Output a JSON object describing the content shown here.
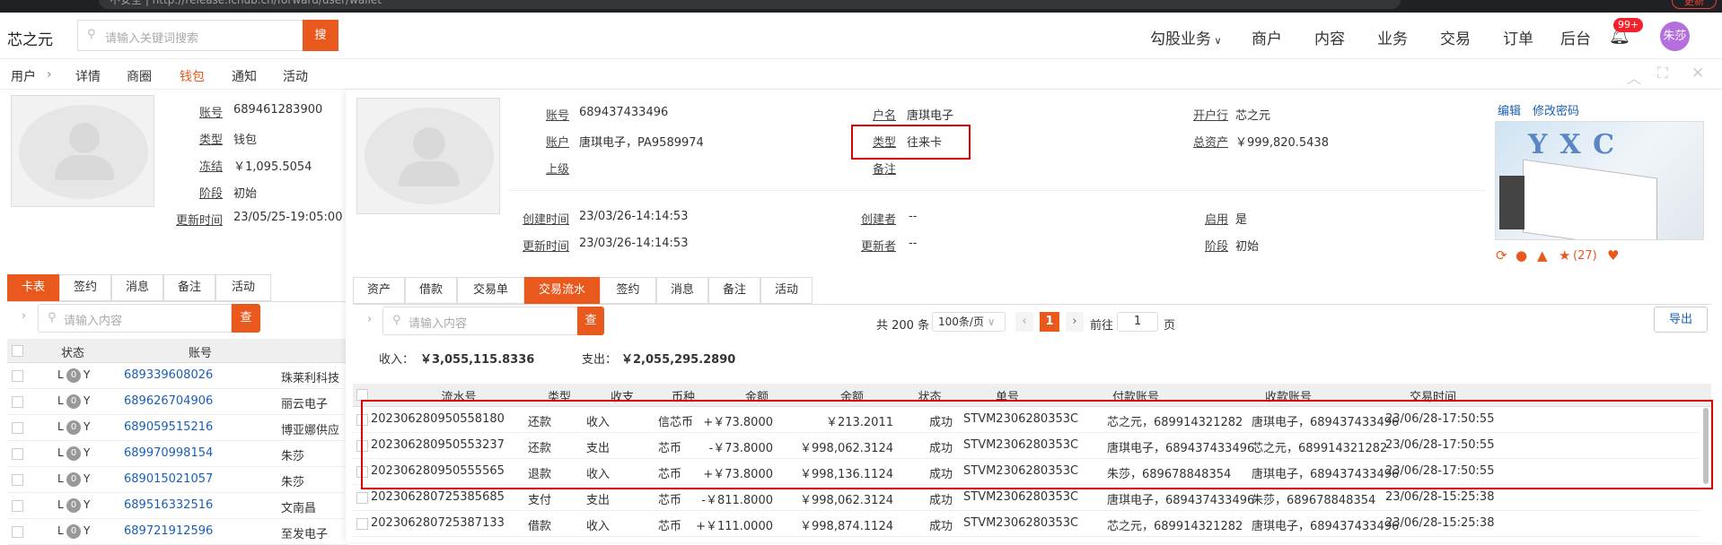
{
  "browser": {
    "url": "不安全 | http://release.ichub.cn/forward/user/wallet",
    "update": "更新"
  },
  "header": {
    "logo": "芯之元",
    "search_placeholder": "请输入关键词搜索",
    "search_btn": "搜",
    "nav": [
      "勾股业务",
      "商户",
      "内容",
      "业务",
      "交易",
      "订单",
      "后台"
    ],
    "badge": "99+",
    "user": "朱莎"
  },
  "crumbs": [
    "用户",
    "详情",
    "商圈",
    "钱包",
    "通知",
    "活动"
  ],
  "left": {
    "labels": [
      "账号",
      "类型",
      "冻结",
      "阶段",
      "更新时间"
    ],
    "values": [
      "689461283900",
      "钱包",
      "￥1,095.5054",
      "初始",
      "23/05/25-19:05:00"
    ],
    "tabs": [
      "卡表",
      "签约",
      "消息",
      "备注",
      "活动"
    ],
    "search_placeholder": "请输入内容",
    "search_btn": "查",
    "col_status": "状态",
    "col_account": "账号",
    "rows": [
      {
        "acc": "689339608026",
        "name": "珠莱利科技"
      },
      {
        "acc": "689626704906",
        "name": "丽云电子"
      },
      {
        "acc": "689059515216",
        "name": "博亚娜供应"
      },
      {
        "acc": "689970998154",
        "name": "朱莎"
      },
      {
        "acc": "689015021057",
        "name": "朱莎"
      },
      {
        "acc": "689516332516",
        "name": "文南昌"
      },
      {
        "acc": "689721912596",
        "name": "至发电子"
      }
    ],
    "toggle": {
      "l": "L",
      "v": "0",
      "r": "Y"
    }
  },
  "panel": {
    "info": {
      "account_l": "账号",
      "account": "689437433496",
      "holder_l": "账户",
      "holder": "唐琪电子，PA9589974",
      "parent_l": "上级",
      "name_l": "户名",
      "name": "唐琪电子",
      "type_l": "类型",
      "type": "往来卡",
      "note_l": "备注",
      "bank_l": "开户行",
      "bank": "芯之元",
      "assets_l": "总资产",
      "assets": "￥999,820.5438",
      "ctime_l": "创建时间",
      "ctime": "23/03/26-14:14:53",
      "creator_l": "创建者",
      "creator": "--",
      "enable_l": "启用",
      "enable": "是",
      "utime_l": "更新时间",
      "utime": "23/03/26-14:14:53",
      "updater_l": "更新者",
      "updater": "--",
      "stage_l": "阶段",
      "stage": "初始"
    },
    "edit": "编辑",
    "change_pwd": "修改密码",
    "product": "YXC",
    "stars": "(27)",
    "tabs": [
      "资产",
      "借款",
      "交易单",
      "交易流水",
      "签约",
      "消息",
      "备注",
      "活动"
    ],
    "search_placeholder": "请输入内容",
    "search_btn": "查",
    "pager": {
      "total": "共 200 条",
      "size": "100条/页",
      "page": "1",
      "goto": "前往",
      "goto_val": "1",
      "page_unit": "页"
    },
    "export": "导出",
    "income_l": "收入：",
    "income": "￥3,055,115.8336",
    "expense_l": "支出：",
    "expense": "￥2,055,295.2890",
    "cols": [
      "流水号",
      "类型",
      "收支",
      "币种",
      "金额",
      "余额",
      "状态",
      "单号",
      "付款账号",
      "收款账号",
      "交易时间"
    ],
    "rows": [
      [
        "202306280950558180",
        "还款",
        "收入",
        "信芯币",
        "+￥73.8000",
        "￥213.2011",
        "成功",
        "STVM2306280353C",
        "芯之元，689914321282",
        "唐琪电子，689437433496",
        "23/06/28-17:50:55"
      ],
      [
        "202306280950553237",
        "还款",
        "支出",
        "芯币",
        "-￥73.8000",
        "￥998,062.3124",
        "成功",
        "STVM2306280353C",
        "唐琪电子，689437433496",
        "芯之元，689914321282",
        "23/06/28-17:50:55"
      ],
      [
        "202306280950555565",
        "退款",
        "收入",
        "芯币",
        "+￥73.8000",
        "￥998,136.1124",
        "成功",
        "STVM2306280353C",
        "朱莎，689678848354",
        "唐琪电子，689437433496",
        "23/06/28-17:50:55"
      ],
      [
        "202306280725385685",
        "支付",
        "支出",
        "芯币",
        "-￥811.8000",
        "￥998,062.3124",
        "成功",
        "STVM2306280353C",
        "唐琪电子，689437433496",
        "朱莎，689678848354",
        "23/06/28-15:25:38"
      ],
      [
        "202306280725387133",
        "借款",
        "收入",
        "芯币",
        "+￥111.0000",
        "￥998,874.1124",
        "成功",
        "STVM2306280353C",
        "芯之元，689914321282",
        "唐琪电子，689437433496",
        "23/06/28-15:25:38"
      ]
    ]
  },
  "colors": {
    "accent": "#e9591e",
    "link": "#1a5fb4",
    "highlight": "#e00000"
  }
}
